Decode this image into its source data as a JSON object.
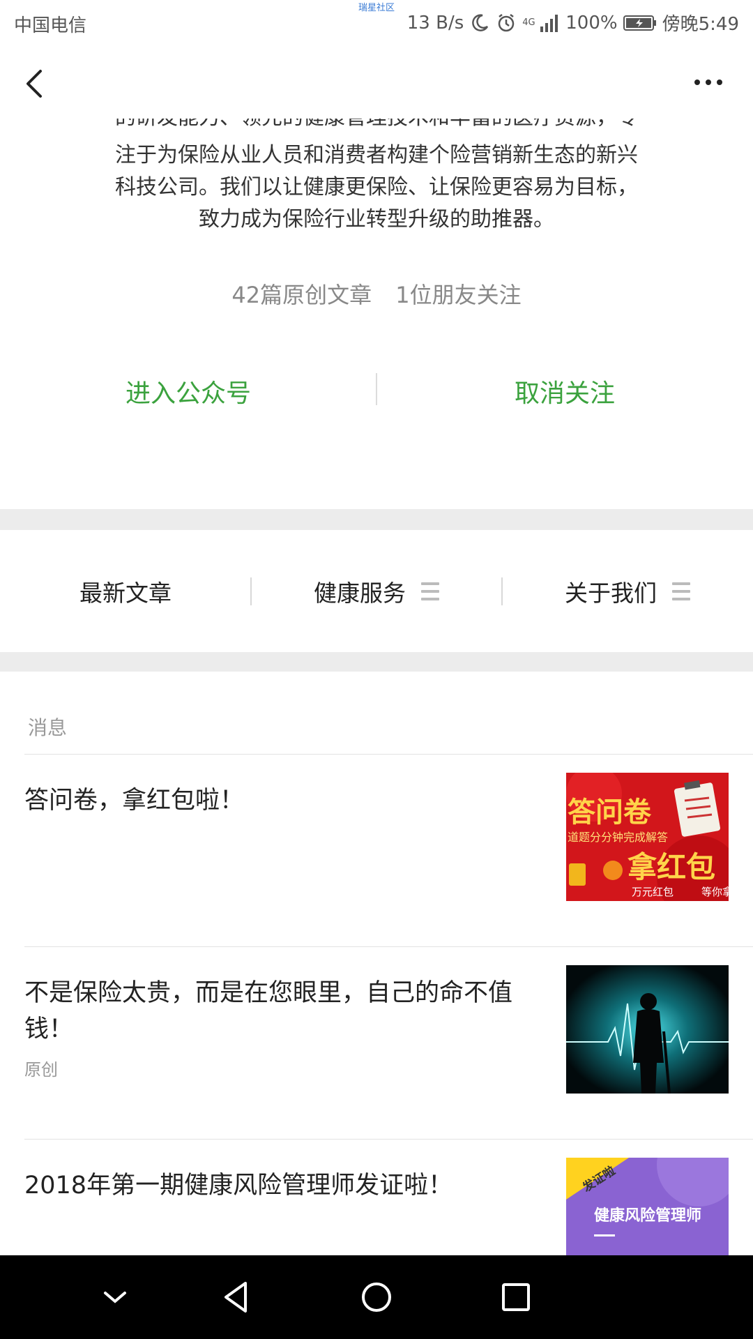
{
  "status_bar": {
    "carrier": "中国电信",
    "watermark": "瑞星社区",
    "speed": "13 B/s",
    "network": "4G",
    "battery": "100%",
    "time": "傍晚5:49",
    "icons": [
      "moon-icon",
      "alarm-icon",
      "signal-icon",
      "battery-icon"
    ]
  },
  "nav": {
    "back_icon": "back-arrow-icon",
    "more_icon": "more-dots-icon"
  },
  "profile": {
    "intro_cut": "的研发能力、领先的健康管理技术和丰富的医疗资源，专",
    "intro_lines": [
      "注于为保险从业人员和消费者构建个险营销新生态的新兴",
      "科技公司。我们以让健康更保险、让保险更容易为目标，",
      "致力成为保险行业转型升级的助推器。"
    ],
    "articles_count": "42篇原创文章",
    "friends_following": "1位朋友关注",
    "enter_label": "进入公众号",
    "unfollow_label": "取消关注",
    "accent_color": "#3ba23e"
  },
  "menu": {
    "items": [
      {
        "label": "最新文章",
        "has_submenu": false
      },
      {
        "label": "健康服务",
        "has_submenu": true
      },
      {
        "label": "关于我们",
        "has_submenu": true
      }
    ]
  },
  "messages": {
    "section_label": "消息",
    "articles": [
      {
        "title": "答问卷，拿红包啦！",
        "tag": "",
        "thumb": {
          "big1": "答问卷",
          "small1": "道题分分钟完成解答",
          "big2": "拿红包",
          "small2": "万元红包",
          "small3": "等你拿"
        }
      },
      {
        "title": "不是保险太贵，而是在您眼里，自己的命不值钱！",
        "tag": "原创",
        "thumb": {}
      },
      {
        "title": "2018年第一期健康风险管理师发证啦！",
        "tag": "",
        "thumb": {
          "ribbon": "发证啦",
          "text": "健康风险管理师"
        }
      }
    ]
  },
  "system_nav": {
    "icons": [
      "collapse-chevron-icon",
      "back-triangle-icon",
      "home-circle-icon",
      "recents-square-icon"
    ]
  }
}
